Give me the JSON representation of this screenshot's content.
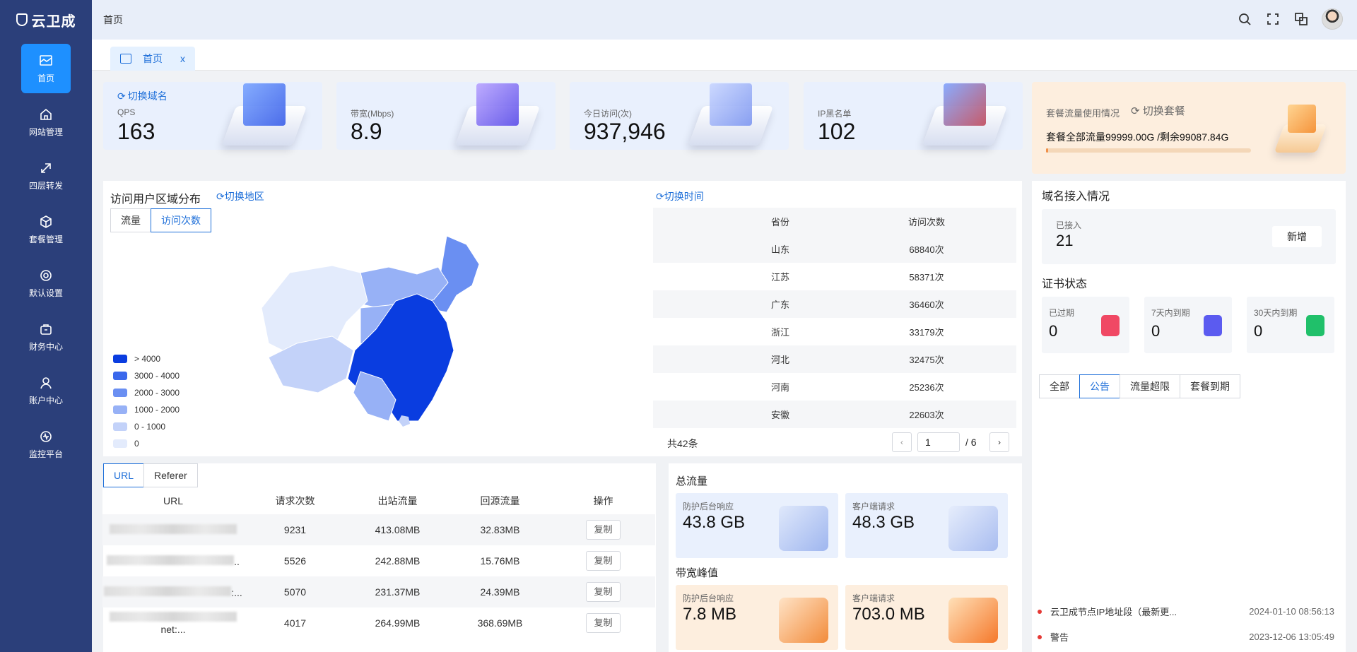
{
  "app": {
    "logo": "云卫成"
  },
  "sidebar": {
    "items": [
      {
        "label": "首页",
        "icon": "dashboard-icon"
      },
      {
        "label": "网站管理",
        "icon": "home-icon"
      },
      {
        "label": "四层转发",
        "icon": "forward-icon"
      },
      {
        "label": "套餐管理",
        "icon": "package-icon"
      },
      {
        "label": "默认设置",
        "icon": "gear-icon"
      },
      {
        "label": "财务中心",
        "icon": "wallet-icon"
      },
      {
        "label": "账户中心",
        "icon": "user-icon"
      },
      {
        "label": "监控平台",
        "icon": "monitor-icon"
      }
    ]
  },
  "header": {
    "breadcrumb": "首页"
  },
  "tabs": [
    {
      "label": "首页",
      "close": "x"
    }
  ],
  "stats": [
    {
      "switch": "切换域名",
      "label": "QPS",
      "value": "163"
    },
    {
      "label": "带宽(Mbps)",
      "value": "8.9"
    },
    {
      "label": "今日访问(次)",
      "value": "937,946"
    },
    {
      "label": "IP黑名单",
      "value": "102"
    }
  ],
  "package": {
    "label": "套餐流量使用情况",
    "switch": "切换套餐",
    "total": "套餐全部流量99999.00G /剩余99087.84G",
    "used_fraction": 0.01
  },
  "region": {
    "title": "访问用户区域分布",
    "switch_region": "切换地区",
    "switch_time": "切换时间",
    "toggle": [
      "流量",
      "访问次数"
    ],
    "legend": [
      {
        "label": "> 4000",
        "color": "#0a3de0"
      },
      {
        "label": "3000 - 4000",
        "color": "#3a68ec"
      },
      {
        "label": "2000 - 3000",
        "color": "#6a8ff2"
      },
      {
        "label": "1000 - 2000",
        "color": "#97b1f6"
      },
      {
        "label": "0 - 1000",
        "color": "#c3d2f9"
      },
      {
        "label": "0",
        "color": "#e3ebfc"
      }
    ],
    "table_headers": [
      "省份",
      "访问次数"
    ],
    "rows": [
      {
        "province": "山东",
        "count": "68840次"
      },
      {
        "province": "江苏",
        "count": "58371次"
      },
      {
        "province": "广东",
        "count": "36460次"
      },
      {
        "province": "浙江",
        "count": "33179次"
      },
      {
        "province": "河北",
        "count": "32475次"
      },
      {
        "province": "河南",
        "count": "25236次"
      },
      {
        "province": "安徽",
        "count": "22603次"
      }
    ],
    "pager": {
      "total": "共42条",
      "page": "1",
      "pages": "/ 6"
    }
  },
  "urltable": {
    "tabs": [
      "URL",
      "Referer"
    ],
    "headers": [
      "URL",
      "请求次数",
      "出站流量",
      "回源流量",
      "操作"
    ],
    "rows": [
      {
        "req": "9231",
        "out": "413.08MB",
        "back": "32.83MB",
        "op": "复制"
      },
      {
        "req": "5526",
        "out": "242.88MB",
        "back": "15.76MB",
        "op": "复制"
      },
      {
        "req": "5070",
        "out": "231.37MB",
        "back": "24.39MB",
        "op": "复制"
      },
      {
        "req": "4017",
        "out": "264.99MB",
        "back": "368.69MB",
        "op": "复制"
      }
    ],
    "url_suffixes": [
      "",
      "..",
      ":...",
      "net:..."
    ]
  },
  "traffic": {
    "total_title": "总流量",
    "total": [
      {
        "label": "防护后台响应",
        "value": "43.8 GB"
      },
      {
        "label": "客户端请求",
        "value": "48.3 GB"
      }
    ],
    "peak_title": "带宽峰值",
    "peak": [
      {
        "label": "防护后台响应",
        "value": "7.8 MB"
      },
      {
        "label": "客户端请求",
        "value": "703.0 MB"
      }
    ]
  },
  "domain": {
    "title": "域名接入情况",
    "connected_label": "已接入",
    "connected": "21",
    "add": "新增"
  },
  "cert": {
    "title": "证书状态",
    "items": [
      {
        "label": "已过期",
        "value": "0",
        "color": "#f04864"
      },
      {
        "label": "7天内到期",
        "value": "0",
        "color": "#5b5bf0"
      },
      {
        "label": "30天内到期",
        "value": "0",
        "color": "#20c06a"
      }
    ]
  },
  "notices": {
    "tabs": [
      "全部",
      "公告",
      "流量超限",
      "套餐到期"
    ],
    "items": [
      {
        "title": "云卫成节点IP地址段（最新更...",
        "date": "2024-01-10 08:56:13"
      },
      {
        "title": "警告",
        "date": "2023-12-06 13:05:49"
      }
    ]
  }
}
